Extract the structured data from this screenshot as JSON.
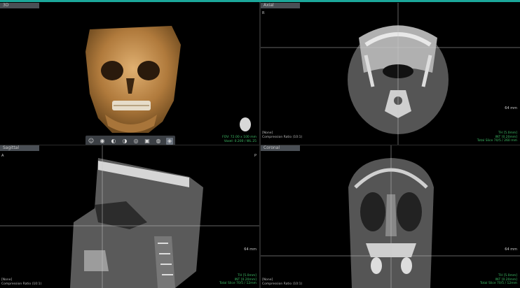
{
  "panes": {
    "vr": {
      "title": "3D",
      "info": [
        "FOV: 72.00 x 100 mm",
        "Voxel: 0.200 / WL 25"
      ]
    },
    "axial": {
      "title": "Axial",
      "left": "R",
      "scale": "64 mm",
      "none": "[None]",
      "comp": "Compression Ratio (10:1)",
      "info": [
        "TH [5.0mm]",
        "INT [0.20mm]",
        "Total Slice 70/5 / 260 mm"
      ]
    },
    "sagittal": {
      "title": "Sagittal",
      "left": "A",
      "right": "P",
      "scale": "64 mm",
      "none": "[None]",
      "comp": "Compression Ratio (10:1)",
      "info": [
        "TH [5.0mm]",
        "INT [0.20mm]",
        "Total Slice 70/5 / 12mm"
      ]
    },
    "coronal": {
      "title": "Coronal",
      "scale": "64 mm",
      "none": "[None]",
      "comp": "Compression Ratio (10:1)",
      "info": [
        "TH [5.0mm]",
        "INT [0.20mm]",
        "Total Slice 70/5 / 12mm"
      ]
    }
  },
  "toolbar": {
    "icons": [
      "face-icon",
      "skull-front-icon",
      "skull-side-icon",
      "skull-oblique-icon",
      "bone-icon",
      "teeth-icon",
      "soft-tissue-icon",
      "settings-icon"
    ],
    "glyphs": [
      "☺",
      "◉",
      "◐",
      "◑",
      "◎",
      "▣",
      "◍",
      "◈"
    ]
  },
  "colors": {
    "accent": "#1ba79a",
    "info_text": "#3fbf67",
    "crosshair": "#c9c9c9"
  }
}
